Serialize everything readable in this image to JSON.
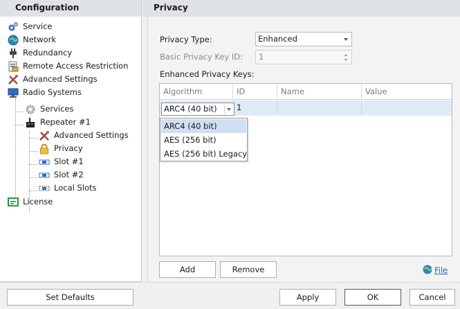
{
  "left_panel": {
    "title": "Configuration",
    "tree": [
      {
        "label": "Service",
        "icon": "service-icon"
      },
      {
        "label": "Network",
        "icon": "network-globe-icon"
      },
      {
        "label": "Redundancy",
        "icon": "redundancy-plug-icon"
      },
      {
        "label": "Remote Access Restriction",
        "icon": "remote-access-icon"
      },
      {
        "label": "Advanced Settings",
        "icon": "tools-icon"
      },
      {
        "label": "Radio Systems",
        "icon": "radio-systems-monitor-icon"
      },
      {
        "label": "Services",
        "icon": "gear-icon"
      },
      {
        "label": "Repeater #1",
        "icon": "repeater-icon"
      },
      {
        "label": "Advanced Settings",
        "icon": "tools-icon"
      },
      {
        "label": "Privacy",
        "icon": "lock-icon",
        "selected": true
      },
      {
        "label": "Slot #1",
        "icon": "slot-icon"
      },
      {
        "label": "Slot #2",
        "icon": "slot-icon"
      },
      {
        "label": "Local Slots",
        "icon": "local-slots-icon"
      },
      {
        "label": "License",
        "icon": "license-icon"
      }
    ]
  },
  "right_panel": {
    "title": "Privacy",
    "privacy_type_label": "Privacy Type:",
    "privacy_type_value": "Enhanced",
    "basic_key_label": "Basic Privacy Key ID:",
    "basic_key_value": "1",
    "enhanced_keys_label": "Enhanced Privacy Keys:",
    "grid": {
      "columns": [
        "Algorithm",
        "ID",
        "Name",
        "Value"
      ],
      "rows": [
        {
          "algorithm": "ARC4 (40 bit)",
          "id": "1",
          "name": "",
          "value": ""
        }
      ]
    },
    "dropdown_options": [
      "ARC4 (40 bit)",
      "AES (256 bit)",
      "AES (256 bit) Legacy"
    ],
    "add_button": "Add",
    "remove_button": "Remove",
    "file_link": "File"
  },
  "footer": {
    "set_defaults": "Set Defaults",
    "apply": "Apply",
    "ok": "OK",
    "cancel": "Cancel"
  },
  "colors": {
    "header_bg": "#dfe3e8",
    "selection": "#dfeaf7",
    "dropdown_highlight": "#cfe0f4",
    "link": "#1f5fbf"
  }
}
